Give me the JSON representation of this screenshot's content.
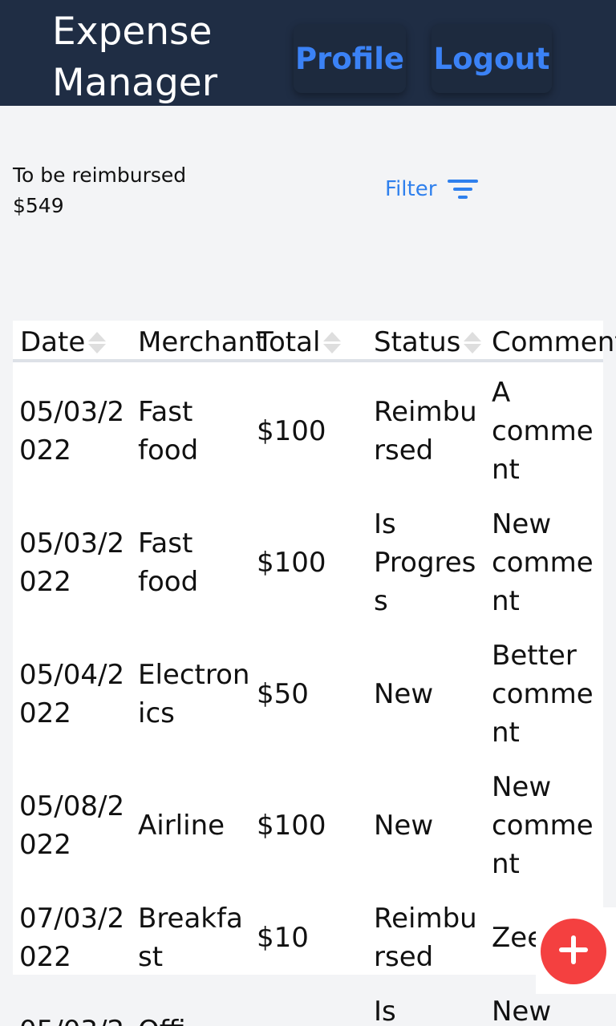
{
  "header": {
    "title": "Expense\nManager",
    "profile_label": "Profile",
    "logout_label": "Logout"
  },
  "summary": {
    "label": "To be reimbursed",
    "amount": "$549"
  },
  "filter": {
    "label": "Filter",
    "icon": "filter-icon"
  },
  "table": {
    "columns": [
      "Date",
      "Merchant",
      "Total",
      "Status",
      "Comment"
    ],
    "rows": [
      {
        "date": "05/03/2\n022",
        "merchant": "Fast\nfood",
        "total": "$100",
        "status": "Reimbu\nrsed",
        "comment": "A\ncomme\nnt"
      },
      {
        "date": "05/03/2\n022",
        "merchant": "Fast\nfood",
        "total": "$100",
        "status": "Is\nProgres\ns",
        "comment": "New\ncomme\nnt"
      },
      {
        "date": "05/04/2\n022",
        "merchant": "Electron\nics",
        "total": "$50",
        "status": "New",
        "comment": "Better\ncomme\nnt"
      },
      {
        "date": "05/08/2\n022",
        "merchant": "Airline",
        "total": "$100",
        "status": "New",
        "comment": "New\ncomme\nnt"
      },
      {
        "date": "07/03/2\n022",
        "merchant": "Breakfa\nst",
        "total": "$10",
        "status": "Reimbu\nrsed",
        "comment": "Zee"
      },
      {
        "date": "05/03/2",
        "merchant": "Offi",
        "total": "",
        "status": "Is",
        "comment": "New"
      }
    ]
  },
  "fab": {
    "icon": "plus-icon",
    "color": "#f44040"
  },
  "colors": {
    "header_bg": "#1f2d44",
    "accent": "#3b82f6",
    "filter": "#2f80ed"
  }
}
